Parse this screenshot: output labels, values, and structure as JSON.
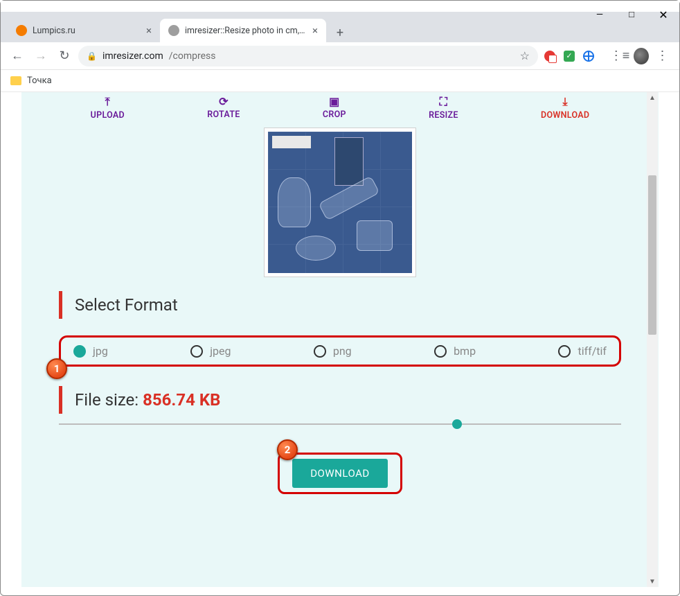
{
  "window": {
    "min": "—",
    "max": "□",
    "close": "✕"
  },
  "tabs": [
    {
      "title": "Lumpics.ru",
      "favcolor": "#f57c00",
      "active": false
    },
    {
      "title": "imresizer::Resize photo in cm, mm",
      "favcolor": "#9e9e9e",
      "active": true
    }
  ],
  "newtab": "+",
  "toolbar": {
    "back": "←",
    "forward": "→",
    "reload": "↻",
    "host": "imresizer.com",
    "path": "/compress",
    "star": "☆",
    "readlist": "⋮≡",
    "kebab": "⋮"
  },
  "bookmarks": {
    "folder_label": "Точка"
  },
  "steps": {
    "upload": "UPLOAD",
    "rotate": "ROTATE",
    "crop": "CROP",
    "resize": "RESIZE",
    "download": "DOWNLOAD",
    "icons": {
      "upload": "⤒",
      "rotate": "⟳",
      "crop": "▣",
      "resize": "⛶",
      "download": "⤓"
    }
  },
  "section": {
    "select_format": "Select Format",
    "file_size_label": "File size: ",
    "file_size_value": "856.74 KB"
  },
  "formats": {
    "jpg": "jpg",
    "jpeg": "jpeg",
    "png": "png",
    "bmp": "bmp",
    "tiff": "tiff/tif",
    "selected": "jpg"
  },
  "markers": {
    "one": "1",
    "two": "2"
  },
  "download_btn": "DOWNLOAD",
  "colors": {
    "accent": "#1aa89a",
    "highlight": "#d40000",
    "purple": "#6a1b9a",
    "red": "#d93025"
  }
}
